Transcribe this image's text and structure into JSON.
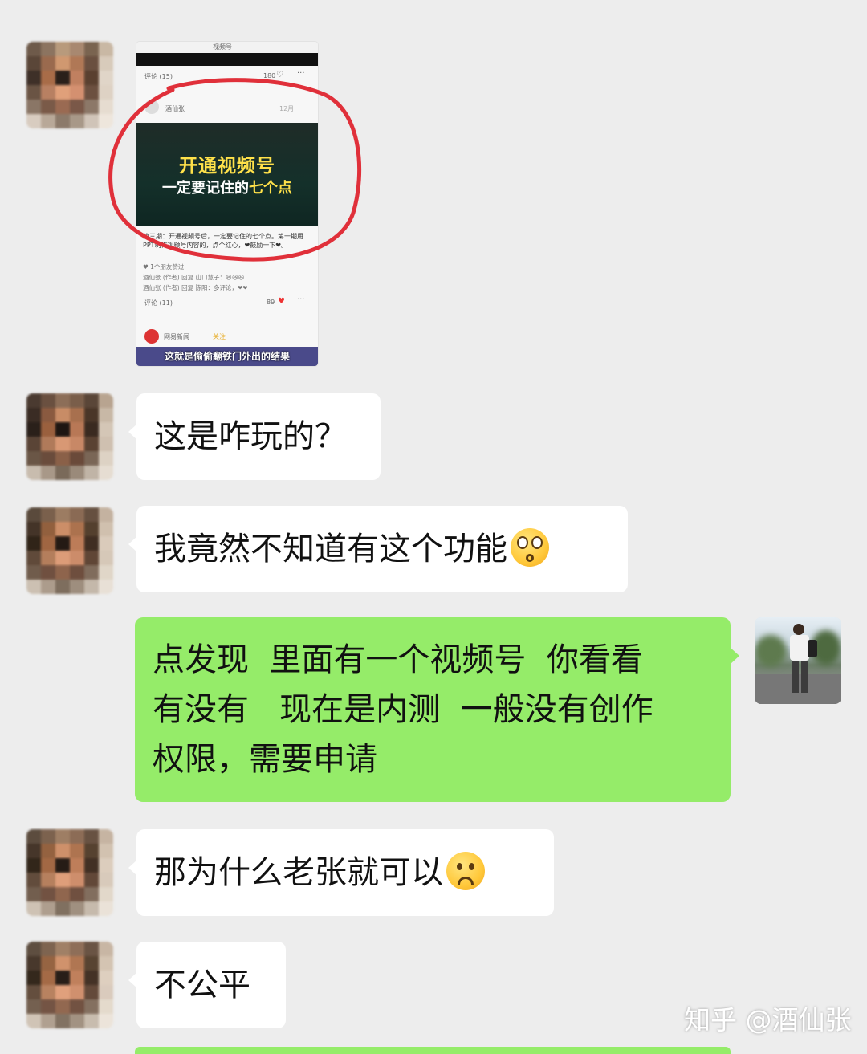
{
  "colors": {
    "background": "#ededed",
    "incoming_bubble": "#ffffff",
    "outgoing_bubble": "#95ec69",
    "highlight_circle": "#e0303a"
  },
  "shared_screenshot": {
    "header_center": "视频号",
    "comment_count_top": "评论 (15)",
    "likes_top": "180",
    "author": "酒仙张",
    "post_time": "12月",
    "video_title_line1": "开通视频号",
    "video_title_line2_plain": "一定要记住的",
    "video_title_line2_highlight": "七个点",
    "description": "第三期：开通视频号后，一定要记住的七个点。第一期用PPT制作视频号内容的，点个红心，❤鼓励一下❤。",
    "friends_liked": "1个朋友赞过",
    "reply_1": "酒仙张 (作者) 回复 山口慧子：😆😆😆",
    "reply_2": "酒仙张 (作者) 回复 陈阳：多评论，❤❤",
    "comment_count_bottom": "评论 (11)",
    "likes_bottom": "89",
    "next_source": "网易新闻",
    "next_follow": "关注",
    "subtitle": "这就是偷偷翻铁门外出的结果"
  },
  "messages": [
    {
      "from": "other",
      "text": "这是咋玩的？"
    },
    {
      "from": "other",
      "text": "我竟然不知道有这个功能",
      "emoji": "shocked-emoji"
    },
    {
      "from": "me",
      "line1": "点发现  里面有一个视频号  你看看",
      "line2": "有没有   现在是内测  一般没有创作",
      "line3": "权限，需要申请"
    },
    {
      "from": "other",
      "text": "那为什么老张就可以",
      "emoji": "frown-emoji"
    },
    {
      "from": "other",
      "text": "不公平"
    }
  ],
  "watermark": "知乎 @酒仙张"
}
